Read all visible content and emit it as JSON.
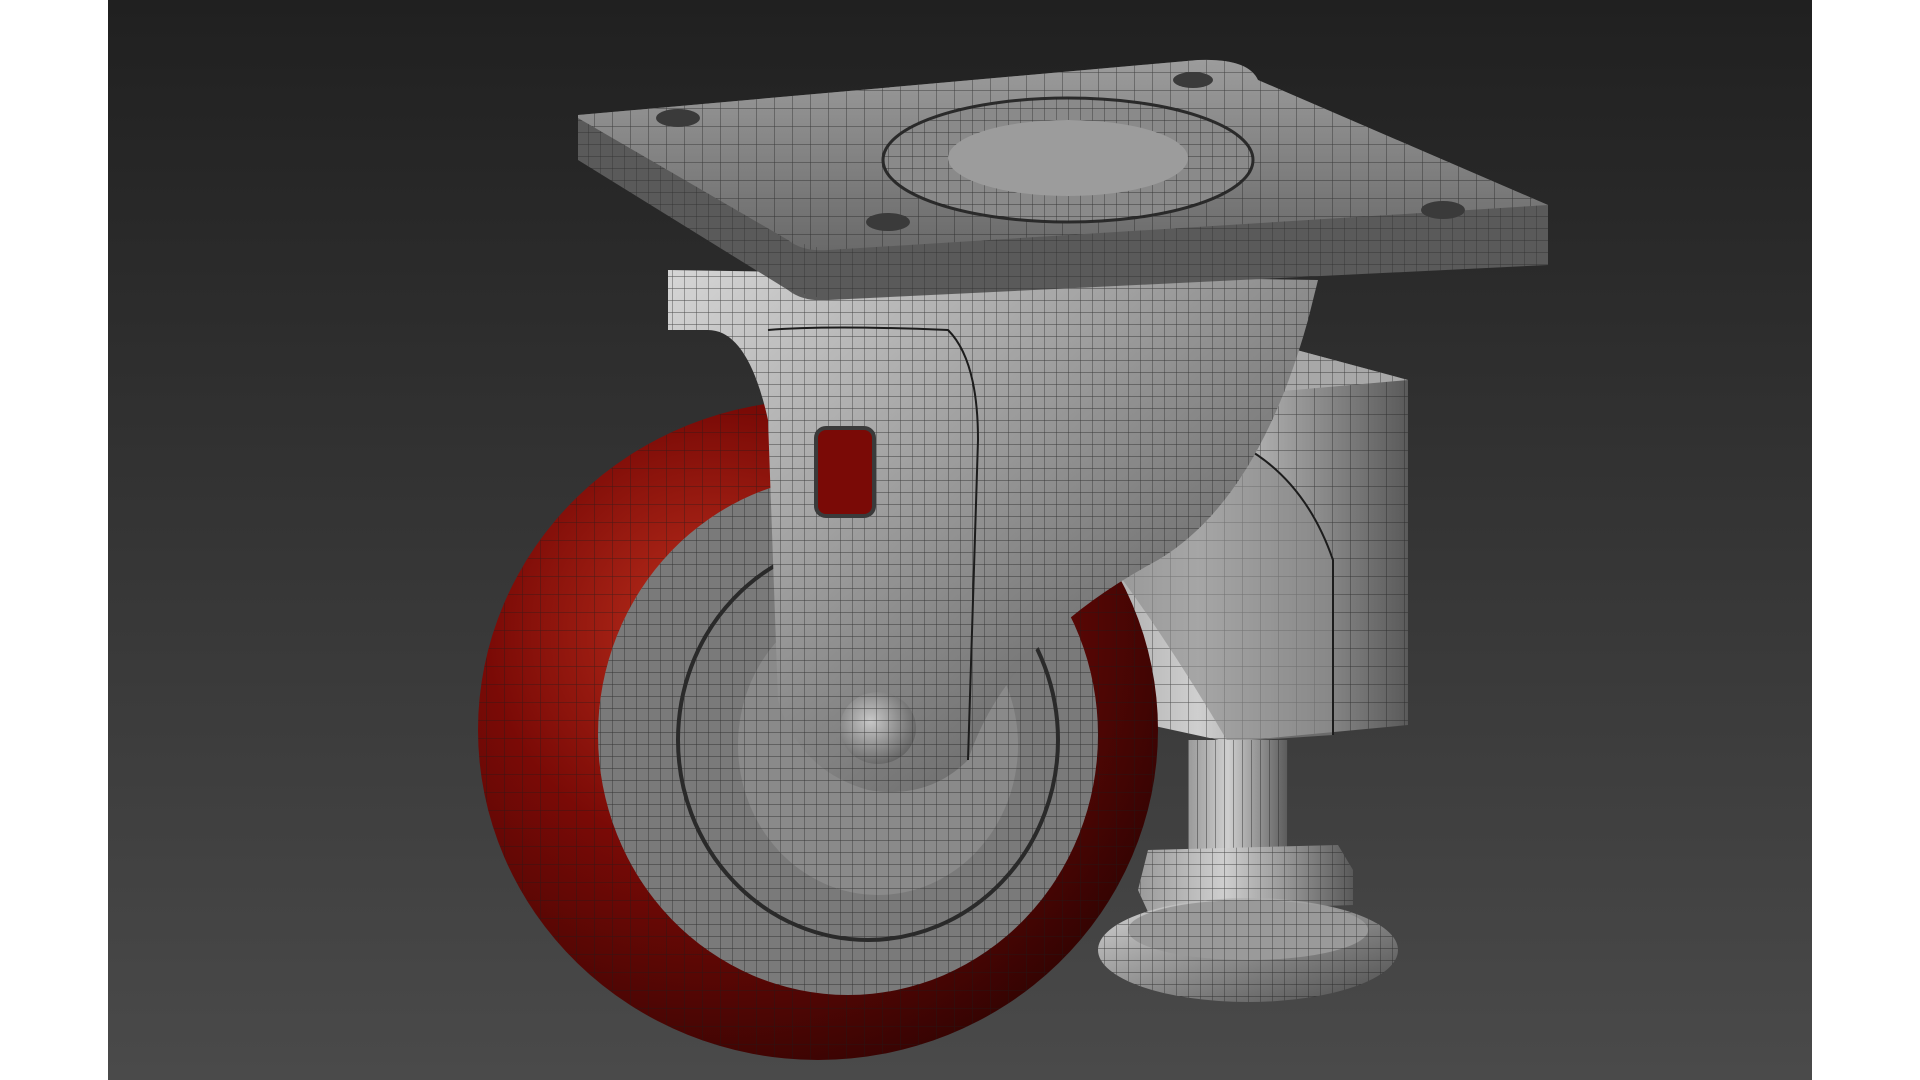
{
  "scene": {
    "subject": "swivel-caster-with-leveling-foot",
    "render_style": "wireframe-over-shaded",
    "colors": {
      "background_top": "#202020",
      "background_bottom": "#4a4a4a",
      "metal": "#8a8a8a",
      "metal_dark": "#4e4e4e",
      "metal_light": "#cfcfcf",
      "wire": "#1c1c1c",
      "tire": "#7a0a06",
      "tire_dark": "#2e0302",
      "tire_light": "#c0301e"
    }
  }
}
